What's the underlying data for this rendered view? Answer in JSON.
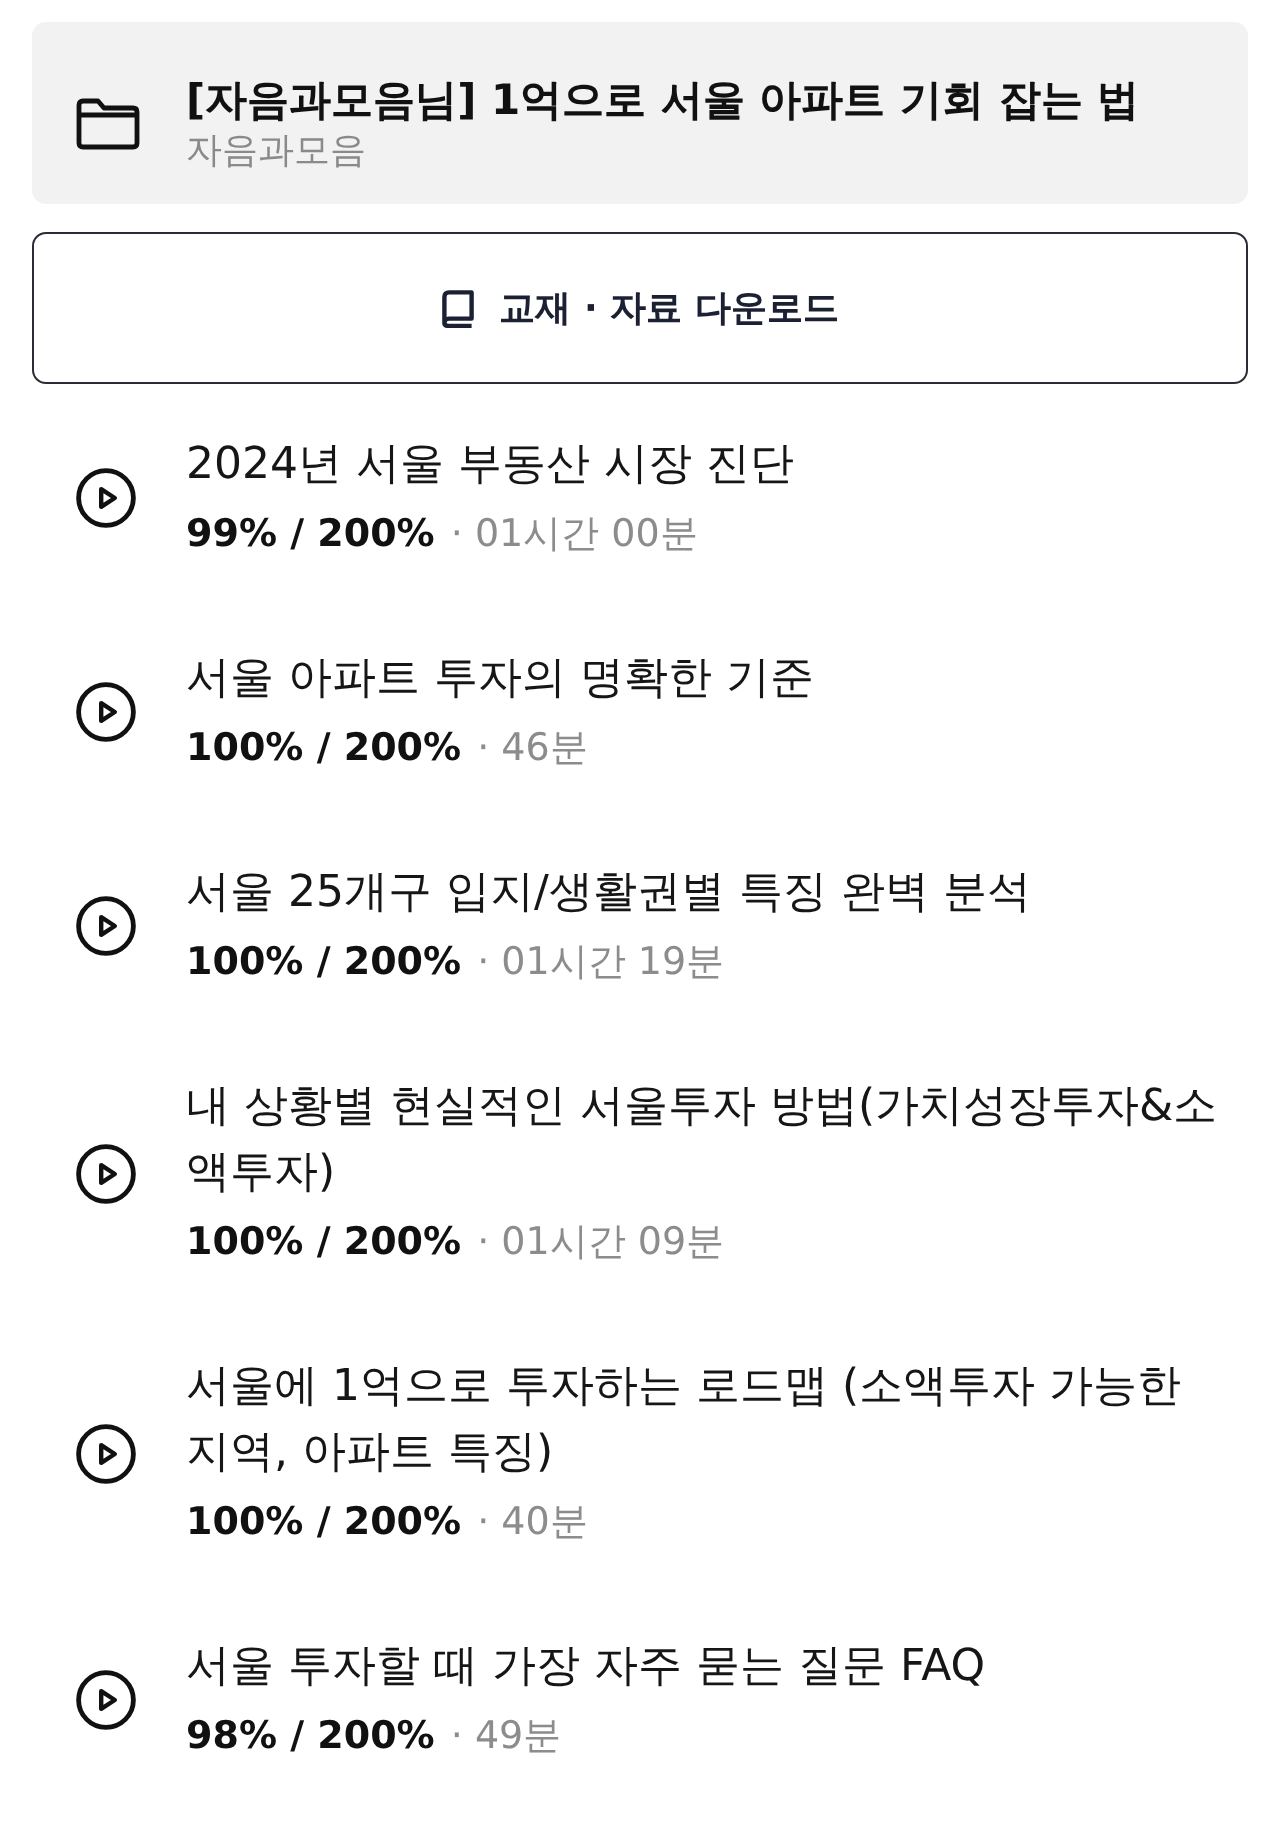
{
  "course": {
    "title": "[자음과모음님] 1억으로 서울 아파트 기회 잡는 법",
    "author": "자음과모음"
  },
  "download_button": {
    "label": "교재 · 자료 다운로드"
  },
  "lectures": [
    {
      "title": "2024년 서울 부동산 시장 진단",
      "progress": "99% / 200%",
      "duration": "· 01시간 00분"
    },
    {
      "title": "서울 아파트 투자의 명확한 기준",
      "progress": "100% / 200%",
      "duration": "· 46분"
    },
    {
      "title": "서울 25개구 입지/생활권별 특징 완벽 분석",
      "progress": "100% / 200%",
      "duration": "· 01시간 19분"
    },
    {
      "title": "내 상황별 현실적인 서울투자 방법(가치성장투자&소액투자)",
      "progress": "100% / 200%",
      "duration": "· 01시간 09분"
    },
    {
      "title": "서울에 1억으로 투자하는 로드맵 (소액투자 가능한 지역, 아파트 특징)",
      "progress": "100% / 200%",
      "duration": "· 40분"
    },
    {
      "title": "서울 투자할 때 가장 자주 묻는 질문 FAQ",
      "progress": "98% / 200%",
      "duration": "· 49분"
    }
  ]
}
